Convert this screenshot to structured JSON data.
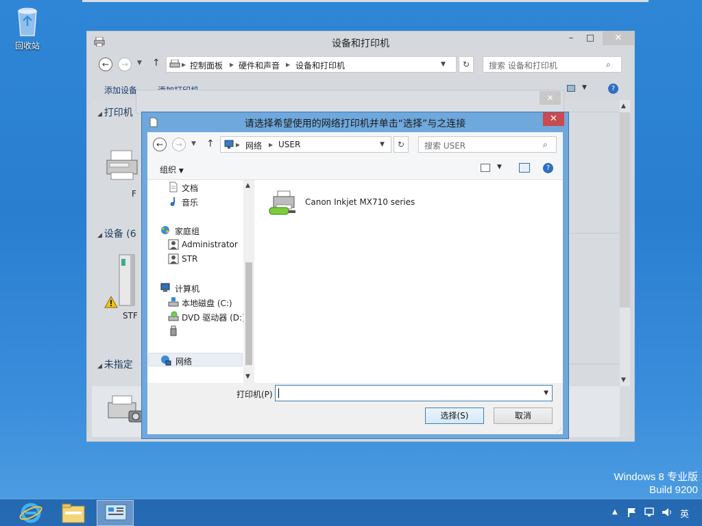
{
  "desktop": {
    "recycle_bin_label": "回收站",
    "watermark_line1": "Windows 8 专业版",
    "watermark_line2": "Build 9200"
  },
  "back_window": {
    "title": "设备和打印机",
    "minimize_glyph": "–",
    "maximize_glyph": "□",
    "close_glyph": "✕",
    "breadcrumb": [
      "控制面板",
      "硬件和声音",
      "设备和打印机"
    ],
    "search_placeholder": "搜索 设备和打印机",
    "commands": [
      "添加设备",
      "添加打印机"
    ],
    "sections": [
      {
        "label": "打印机"
      },
      {
        "label": "设备 (6"
      },
      {
        "label": "未指定"
      }
    ],
    "printer_label_partial": "F",
    "device_label_partial": "STF"
  },
  "middle_dialog": {
    "close_glyph": "✕"
  },
  "dialog": {
    "title": "请选择希望使用的网络打印机并单击“选择”与之连接",
    "close_glyph": "✕",
    "breadcrumb": [
      "网络",
      "USER"
    ],
    "search_placeholder": "搜索 USER",
    "organize_label": "组织",
    "nav_items": [
      {
        "label": "文档",
        "icon": "document-icon"
      },
      {
        "label": "音乐",
        "icon": "music-icon"
      },
      {
        "label": "家庭组",
        "icon": "homegroup-icon"
      },
      {
        "label": "Administrator",
        "icon": "user-icon"
      },
      {
        "label": "STR",
        "icon": "user-icon"
      },
      {
        "label": "计算机",
        "icon": "computer-icon"
      },
      {
        "label": "本地磁盘 (C:)",
        "icon": "drive-icon"
      },
      {
        "label": "DVD 驱动器 (D:)",
        "icon": "dvd-icon"
      },
      {
        "label": "",
        "icon": "usb-drive-icon"
      },
      {
        "label": "网络",
        "icon": "network-icon",
        "selected": true
      }
    ],
    "printers": [
      {
        "name": "Canon Inkjet MX710 series"
      }
    ],
    "printer_field_label": "打印机(P)",
    "printer_field_value": "",
    "select_button": "选择(S)",
    "cancel_button": "取消"
  },
  "taskbar": {
    "ime_label": "英"
  },
  "colors": {
    "desktop_blue": "#2a7ed0",
    "dialog_frame": "#6fa8dc",
    "close_red": "#c74b50"
  }
}
